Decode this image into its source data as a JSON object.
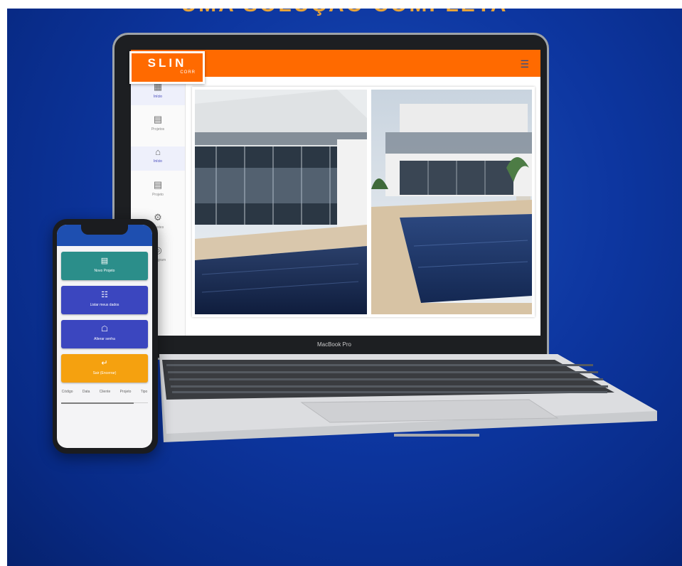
{
  "headline": "UMA SOLUÇÃO COMPLETA",
  "brand": {
    "word": "SLIN",
    "sub": "CORR"
  },
  "colors": {
    "accent": "#ff6a00",
    "background": "#0d36a0",
    "phone_top": "#1e4fb0"
  },
  "appbar": {
    "menu_icon": "menu-icon",
    "menu_glyph": "☰"
  },
  "sidebar": {
    "items": [
      {
        "label": "Início",
        "icon": "dashboard-icon",
        "glyph": "▦"
      },
      {
        "label": "Projetos",
        "icon": "clipboard-icon",
        "glyph": "▤"
      },
      {
        "label": "Início",
        "icon": "home-icon",
        "glyph": "⌂"
      },
      {
        "label": "Projeto",
        "icon": "document-icon",
        "glyph": "▤"
      },
      {
        "label": "Ajustes",
        "icon": "settings-icon",
        "glyph": "⚙"
      },
      {
        "label": "Instagram",
        "icon": "instagram-icon",
        "glyph": "◎"
      }
    ]
  },
  "laptop": {
    "model_label": "MacBook Pro"
  },
  "phone": {
    "buttons": [
      {
        "label": "Novo Projeto",
        "icon": "clipboard-icon",
        "glyph": "▤",
        "color": "#2b8e8a"
      },
      {
        "label": "Listar meus dados",
        "icon": "list-icon",
        "glyph": "☷",
        "color": "#3b46bf"
      },
      {
        "label": "Alterar senha",
        "icon": "lock-icon",
        "glyph": "☖",
        "color": "#3b46bf"
      },
      {
        "label": "Sair (Encerrar)",
        "icon": "exit-icon",
        "glyph": "↵",
        "color": "#f5a10f"
      }
    ],
    "tabs": [
      "Código",
      "Data",
      "Cliente",
      "Projeto",
      "Tipo"
    ]
  }
}
